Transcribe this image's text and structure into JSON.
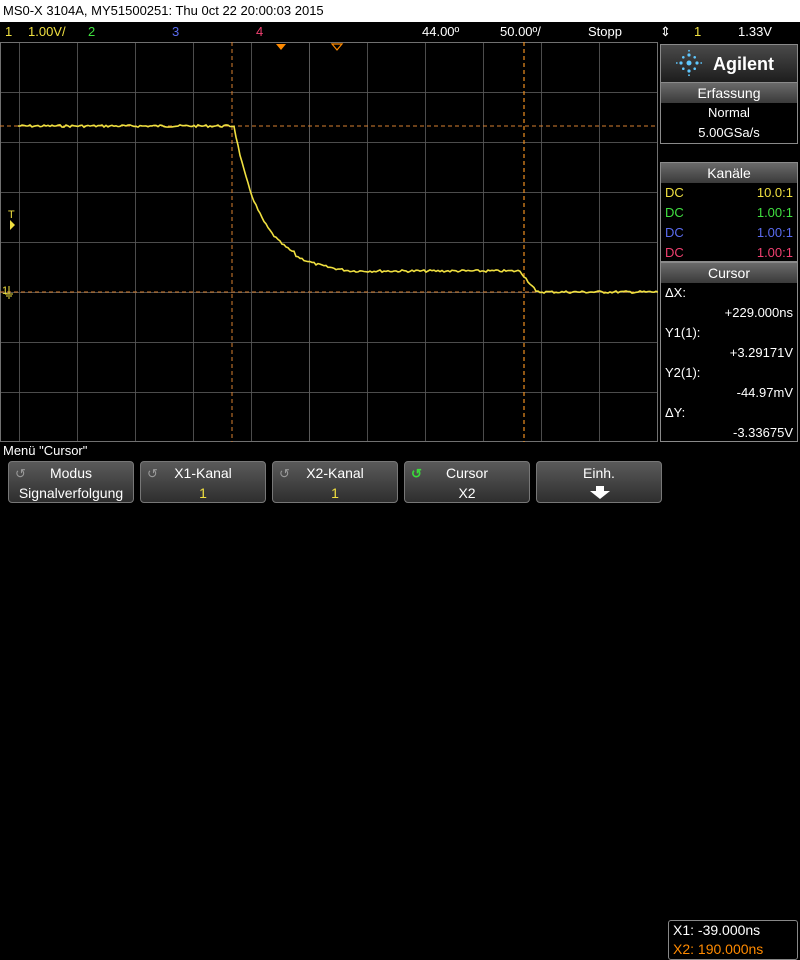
{
  "title": "MS0-X 3104A, MY51500251: Thu 0ct 22 20:00:03 2015",
  "status_bar": {
    "ch1_num": "1",
    "ch1_scale": "1.00V/",
    "ch2_num": "2",
    "ch3_num": "3",
    "ch4_num": "4",
    "time_delay": "44.00º",
    "time_scale": "50.00º/",
    "run_state": "Stopp",
    "trigger_icon": "trigger-edge-icon",
    "trigger_source": "1",
    "trigger_level": "1.33V"
  },
  "colors": {
    "ch1": "#f0e040",
    "ch2": "#40e040",
    "ch3": "#5a6cf0",
    "ch4": "#f04070",
    "cursor_x2": "#ff8a00",
    "grid": "#606060",
    "cursor_line": "#d88030"
  },
  "brand": {
    "name": "Agilent",
    "logo_icon": "agilent-spark-icon"
  },
  "acquisition": {
    "header": "Erfassung",
    "mode": "Normal",
    "rate": "5.00GSa/s"
  },
  "channels": {
    "header": "Kanäle",
    "rows": [
      {
        "coupling": "DC",
        "probe": "10.0:1"
      },
      {
        "coupling": "DC",
        "probe": "1.00:1"
      },
      {
        "coupling": "DC",
        "probe": "1.00:1"
      },
      {
        "coupling": "DC",
        "probe": "1.00:1"
      }
    ]
  },
  "cursor": {
    "header": "Cursor",
    "dx_label": "ΔX:",
    "dx_value": "+229.000ns",
    "y1_label": "Y1(1):",
    "y1_value": "+3.29171V",
    "y2_label": "Y2(1):",
    "y2_value": "-44.97mV",
    "dy_label": "ΔY:",
    "dy_value": "-3.33675V"
  },
  "markers": {
    "trigger_label": "T",
    "ground_label": "1"
  },
  "menu_title": "Menü \"Cursor\"",
  "softkeys": [
    {
      "label": "Modus",
      "value": "Signalverfolgung",
      "icon": "rotate-knob-icon"
    },
    {
      "label": "X1-Kanal",
      "value": "1",
      "icon": "rotate-knob-icon"
    },
    {
      "label": "X2-Kanal",
      "value": "1",
      "icon": "rotate-knob-icon"
    },
    {
      "label": "Cursor",
      "value": "X2",
      "icon": "rotate-knob-icon"
    },
    {
      "label": "Einh.",
      "value": "",
      "icon": "arrow-down-icon"
    }
  ],
  "cursor_readout": {
    "x1": "X1: -39.000ns",
    "x2": "X2: 190.000ns"
  }
}
